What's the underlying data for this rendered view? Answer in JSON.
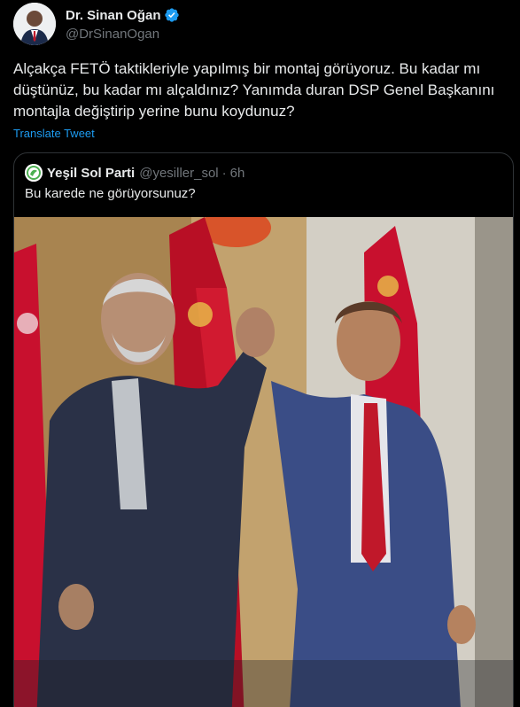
{
  "tweet": {
    "author": {
      "display_name": "Dr. Sinan Oğan",
      "handle": "@DrSinanOgan",
      "verified": true,
      "avatar_icon": "profile-photo"
    },
    "text": "Alçakça FETÖ taktikleriyle yapılmış bir montaj görüyoruz. Bu kadar mı düştünüz, bu kadar mı alçaldınız? Yanımda duran DSP Genel Başkanını montajla değiştirip yerine bunu koydunuz?",
    "translate_label": "Translate Tweet"
  },
  "quote": {
    "author": {
      "display_name": "Yeşil Sol Parti",
      "handle": "@yesiller_sol",
      "separator": "·",
      "time": "6h",
      "avatar_icon": "party-logo"
    },
    "text": "Bu karede ne görüyorsunuz?",
    "media": "photo of two men in suits raising clasped hands in front of red flags"
  },
  "colors": {
    "background": "#000000",
    "primary_text": "#e7e9ea",
    "secondary_text": "#71767b",
    "link": "#1d9bf0",
    "border": "#2f3336",
    "verified": "#1d9bf0"
  }
}
